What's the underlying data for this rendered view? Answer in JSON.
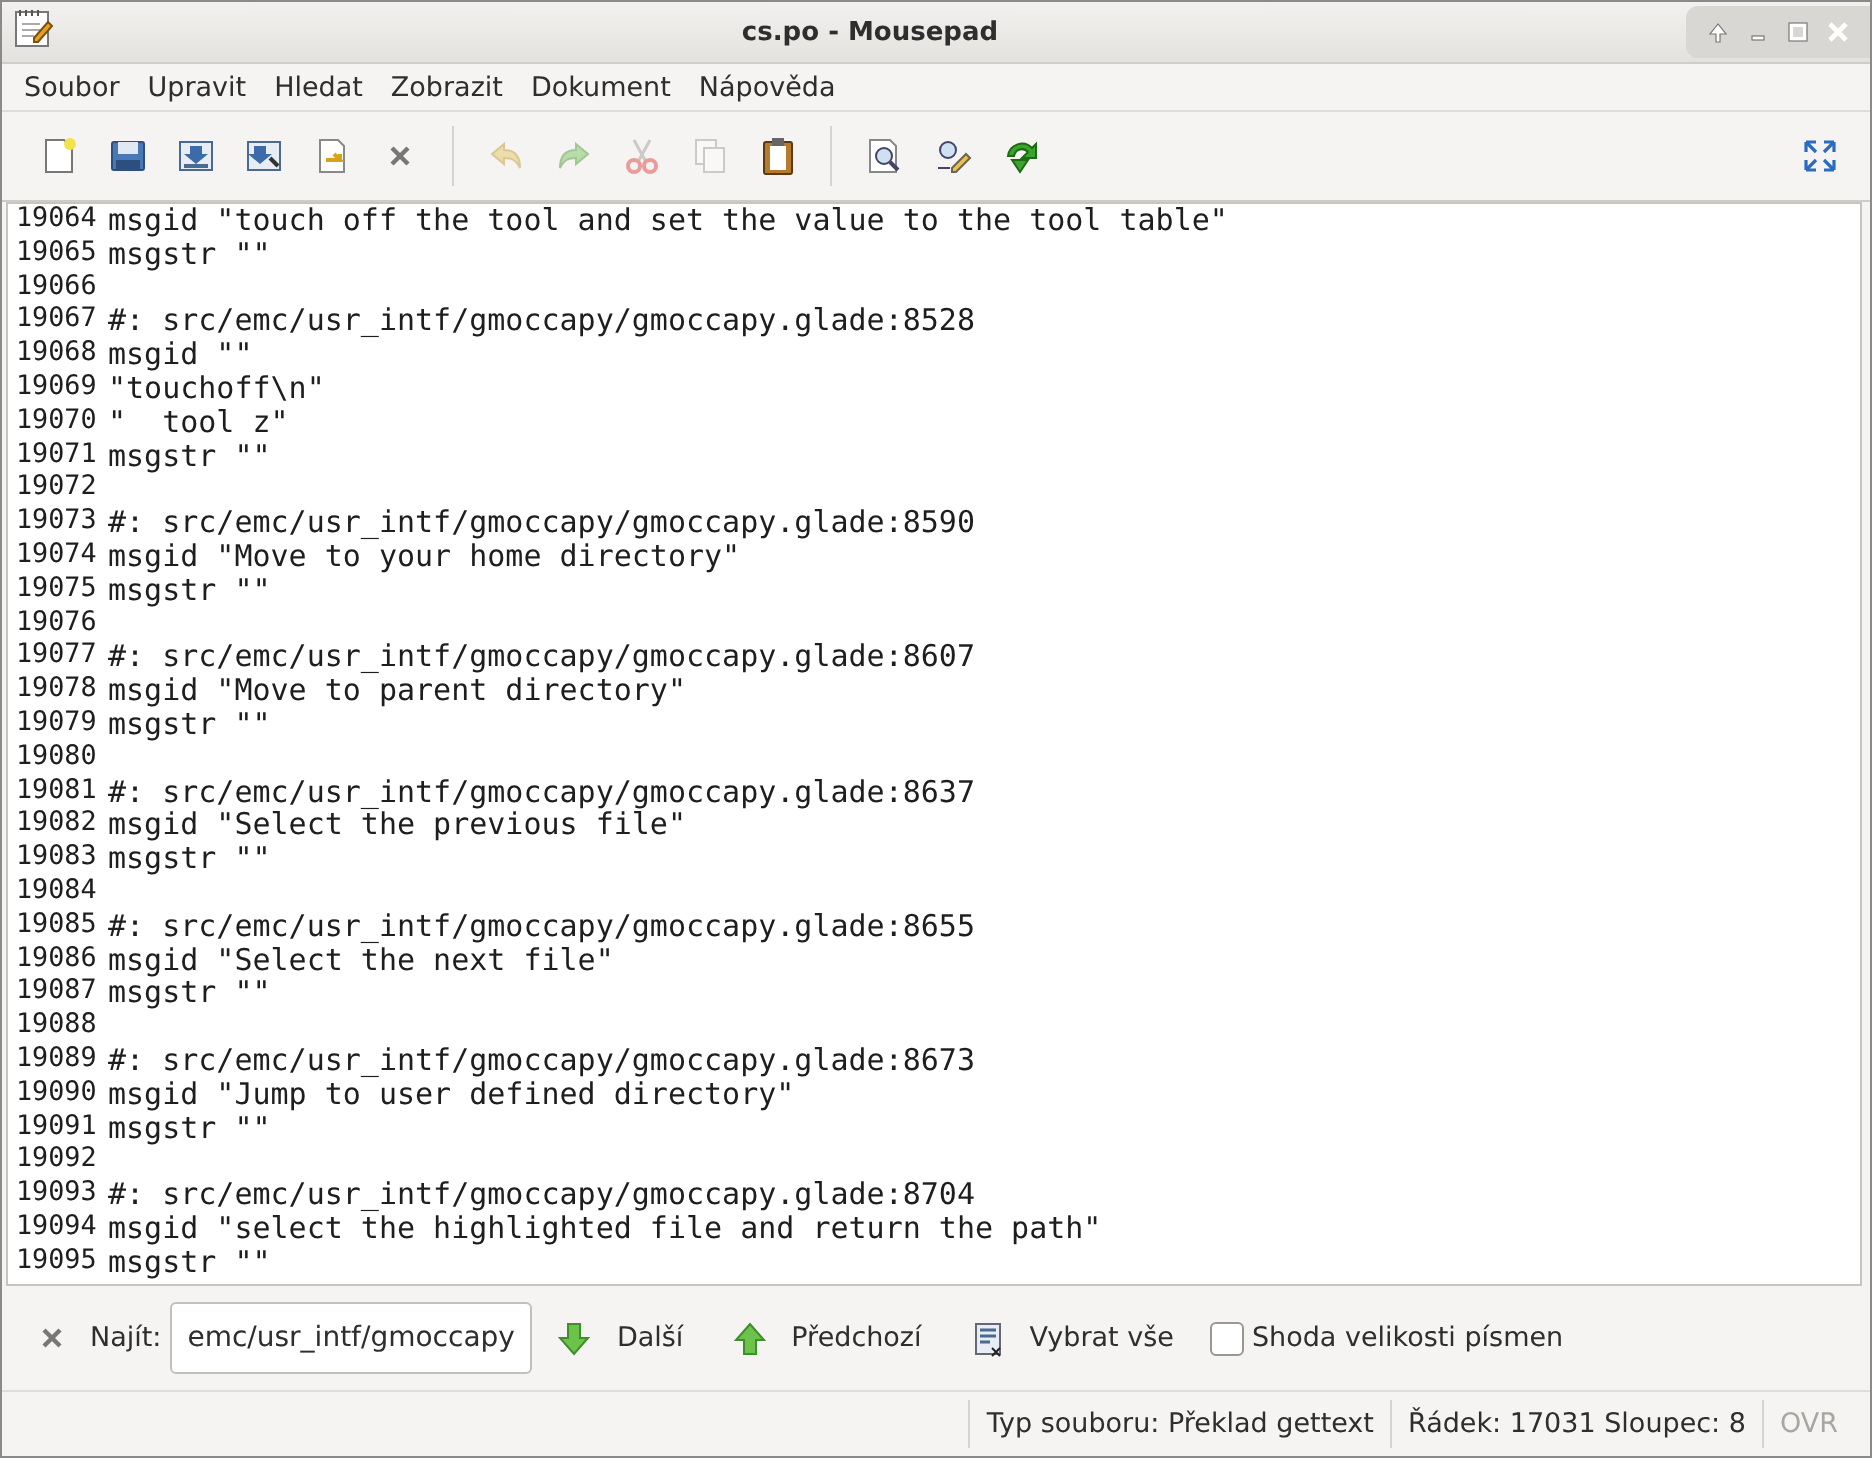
{
  "window": {
    "title": "cs.po - Mousepad"
  },
  "menu": [
    "Soubor",
    "Upravit",
    "Hledat",
    "Zobrazit",
    "Dokument",
    "Nápověda"
  ],
  "toolbar": [
    {
      "kind": "new",
      "disabled": false
    },
    {
      "kind": "open",
      "disabled": false
    },
    {
      "kind": "save",
      "disabled": false
    },
    {
      "kind": "save_as",
      "disabled": false
    },
    {
      "kind": "reload",
      "disabled": false
    },
    {
      "kind": "close",
      "disabled": false
    },
    {
      "kind": "separator"
    },
    {
      "kind": "undo",
      "disabled": true
    },
    {
      "kind": "redo",
      "disabled": true
    },
    {
      "kind": "cut",
      "disabled": true
    },
    {
      "kind": "copy",
      "disabled": true
    },
    {
      "kind": "paste",
      "disabled": false
    },
    {
      "kind": "separator"
    },
    {
      "kind": "find",
      "disabled": false
    },
    {
      "kind": "replace",
      "disabled": false
    },
    {
      "kind": "goto",
      "disabled": false
    },
    {
      "kind": "spacer"
    },
    {
      "kind": "fullscreen",
      "disabled": false
    }
  ],
  "editor": {
    "lines": [
      {
        "number": "19064",
        "text": "msgid \"touch off the tool and set the value to the tool table\""
      },
      {
        "number": "19065",
        "text": "msgstr \"\""
      },
      {
        "number": "19066"
      },
      {
        "number": "19067",
        "text": "#: src/emc/usr_intf/gmoccapy/gmoccapy.glade:8528"
      },
      {
        "number": "19068",
        "text": "msgid \"\""
      },
      {
        "number": "19069",
        "text": "\"touchoff\\n\""
      },
      {
        "number": "19070",
        "text": "\"  tool z\""
      },
      {
        "number": "19071",
        "text": "msgstr \"\""
      },
      {
        "number": "19072"
      },
      {
        "number": "19073",
        "text": "#: src/emc/usr_intf/gmoccapy/gmoccapy.glade:8590"
      },
      {
        "number": "19074",
        "text": "msgid \"Move to your home directory\""
      },
      {
        "number": "19075",
        "text": "msgstr \"\""
      },
      {
        "number": "19076"
      },
      {
        "number": "19077",
        "text": "#: src/emc/usr_intf/gmoccapy/gmoccapy.glade:8607"
      },
      {
        "number": "19078",
        "text": "msgid \"Move to parent directory\""
      },
      {
        "number": "19079",
        "text": "msgstr \"\""
      },
      {
        "number": "19080"
      },
      {
        "number": "19081",
        "text": "#: src/emc/usr_intf/gmoccapy/gmoccapy.glade:8637"
      },
      {
        "number": "19082",
        "text": "msgid \"Select the previous file\""
      },
      {
        "number": "19083",
        "text": "msgstr \"\""
      },
      {
        "number": "19084"
      },
      {
        "number": "19085",
        "text": "#: src/emc/usr_intf/gmoccapy/gmoccapy.glade:8655"
      },
      {
        "number": "19086",
        "text": "msgid \"Select the next file\""
      },
      {
        "number": "19087",
        "text": "msgstr \"\""
      },
      {
        "number": "19088"
      },
      {
        "number": "19089",
        "text": "#: src/emc/usr_intf/gmoccapy/gmoccapy.glade:8673"
      },
      {
        "number": "19090",
        "text": "msgid \"Jump to user defined directory\""
      },
      {
        "number": "19091",
        "text": "msgstr \"\""
      },
      {
        "number": "19092"
      },
      {
        "number": "19093",
        "text": "#: src/emc/usr_intf/gmoccapy/gmoccapy.glade:8704"
      },
      {
        "number": "19094",
        "text": "msgid \"select the highlighted file and return the path\""
      },
      {
        "number": "19095",
        "text": "msgstr \"\""
      }
    ]
  },
  "find_bar": {
    "label": "Najít:",
    "value": "emc/usr_intf/gmoccapy",
    "buttons": [
      {
        "kind": "next",
        "label": "Další"
      },
      {
        "kind": "previous",
        "label": "Předchozí"
      },
      {
        "kind": "select_all",
        "label": "Vybrat vše"
      }
    ],
    "match_case": {
      "label": "Shoda velikosti písmen",
      "checked": false
    }
  },
  "status_bar": {
    "file_type": "Typ souboru: Překlad gettext",
    "position": "Řádek: 17031 Sloupec: 8",
    "overwrite": {
      "label": "OVR",
      "active": false
    }
  }
}
